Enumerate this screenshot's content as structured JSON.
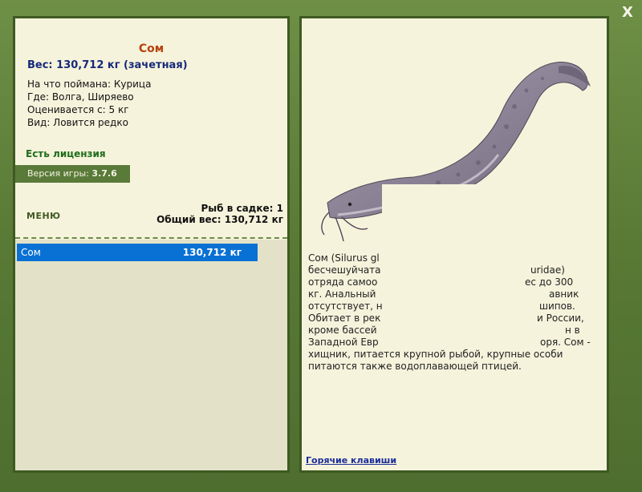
{
  "window": {
    "close_label": "X"
  },
  "fish": {
    "name": "Сом",
    "weight": "Вес: 130,712 кг (зачетная)",
    "caught_on": "На что поймана: Курица",
    "location": "Где: Волга, Ширяево",
    "rated_from": "Оценивается с: 5 кг",
    "rarity": "Вид: Ловится редко"
  },
  "license": "Есть лицензия",
  "version": {
    "label": "Версия игры:",
    "value": "3.7.6"
  },
  "menu_label": "МЕНЮ",
  "cage": {
    "count": "Рыб в садке: 1",
    "total_weight": "Общий вес: 130,712 кг"
  },
  "catch_list": [
    {
      "name": "Сом",
      "weight": "130,712 кг"
    }
  ],
  "description": "Сом (Silurus gl... бесчешуйчатая... ...uridae) отряда сомооб... ...ес до 300 кг. Анальный ... ...авник отсутствует, ... ...шипов. Обитает в рек... ...и России, кроме бассей... ...н в Западной Евр... ...оря. Сом - хищник, питается крупной рыбой, крупные особи питаются также водоплавающей птицей.",
  "description_lines": [
    "Сом (Silurus gl",
    "бесчешуйчата",
    "uridae)",
    "отряда самоо",
    "ес до 300",
    "кг. Анальный",
    "авник",
    "отсутствует, н",
    "шипов.",
    "Обитает в рек",
    "и России,",
    "кроме бассей",
    "н в",
    "Западной Евр",
    "оря. Сом -",
    "хищник, питается крупной рыбой, крупные особи",
    "питаются также водоплавающей птицей."
  ],
  "hotkeys_label": "Горячие клавиши",
  "colors": {
    "frame": "#5b7a3a",
    "panel": "#f6f3dc",
    "fish_name": "#b5420e",
    "weight": "#162a7a",
    "license": "#1e6e1a",
    "selection": "#0a71d4"
  }
}
